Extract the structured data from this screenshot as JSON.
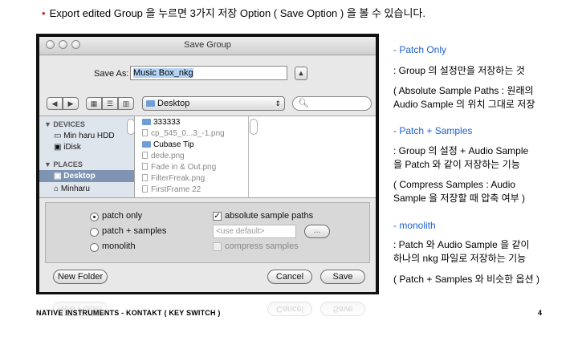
{
  "intro": {
    "text": "Export edited Group 을 누르면 3가지 저장 Option ( Save Option ) 을 볼 수 있습니다."
  },
  "dialog": {
    "title": "Save Group",
    "save_as_label": "Save As:",
    "save_as_value": "Music Box_nkg",
    "location": "Desktop",
    "sidebar": {
      "devices_header": "DEVICES",
      "devices": [
        "Min haru HDD",
        "iDisk"
      ],
      "places_header": "PLACES",
      "places": [
        "Desktop",
        "Minharu"
      ]
    },
    "files": [
      "333333",
      "cp_545_0...3_-1.png",
      "Cubase Tip",
      "dede.png",
      "Fade in & Out.png",
      "FilterFreak.png",
      "FirstFrame 22"
    ],
    "options": {
      "radios": [
        "patch only",
        "patch + samples",
        "monolith"
      ],
      "selected": "patch only",
      "absolute_label": "absolute sample paths",
      "absolute_checked": true,
      "default_placeholder": "<use default>",
      "browse_label": "...",
      "compress_label": "compress samples"
    },
    "buttons": {
      "new_folder": "New Folder",
      "cancel": "Cancel",
      "save": "Save"
    }
  },
  "notes": {
    "patch_only_title": "- Patch Only",
    "patch_only_desc": ": Group 의 설정만을 저장하는 것",
    "abs_line1": "( Absolute Sample Paths : 원래의",
    "abs_line2": "Audio Sample 의 위치 그대로 저장",
    "patch_samples_title": "- Patch + Samples",
    "patch_samples_line1": ": Group 의 설정 + Audio Sample",
    "patch_samples_line2": "을 Patch 와 같이 저장하는 기능",
    "compress_line1": "( Compress Samples : Audio",
    "compress_line2": "Sample 을 저장할 때 압축 여부 )",
    "monolith_title": "- monolith",
    "monolith_line1": ": Patch 와 Audio Sample 을 같이",
    "monolith_line2": "하나의 nkg 파일로 저장하는 기능",
    "monolith_line3": "( Patch + Samples 와 비슷한 옵션 )"
  },
  "footer": {
    "text": "NATIVE INSTRUMENTS - KONTAKT ( KEY SWITCH )",
    "page": "4"
  },
  "colors": {
    "accent_blue": "#1f5fd0",
    "bullet_red": "#d02020",
    "selection": "#b5d3f5"
  }
}
